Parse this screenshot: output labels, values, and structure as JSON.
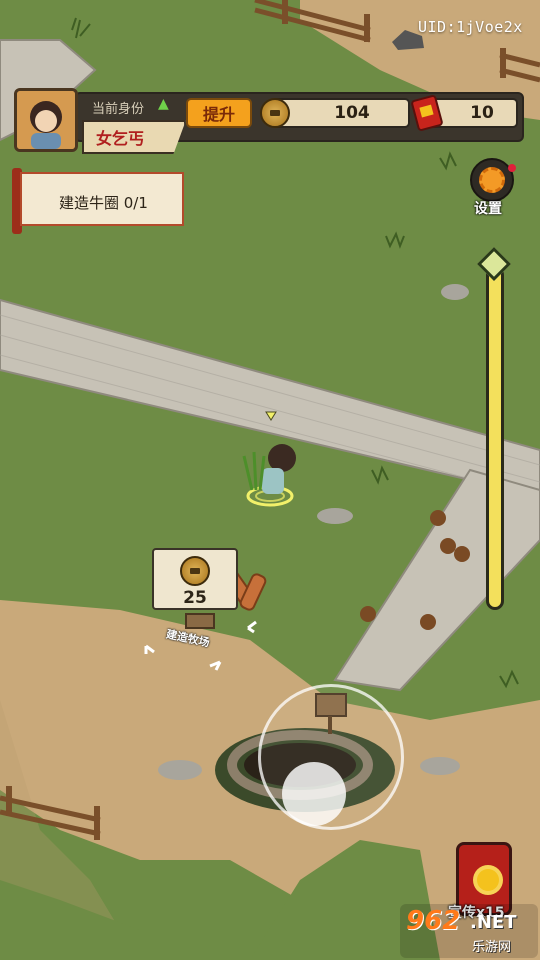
{
  "uid": "UID:1jVoe2x",
  "profile": {
    "identity_label": "当前身份",
    "rank": "女乞丐",
    "upgrade_label": "提升"
  },
  "resources": {
    "coins": "104",
    "tickets": "10"
  },
  "task": {
    "text": "建造牛圈 0/1"
  },
  "settings": {
    "label": "设置"
  },
  "build": {
    "cost": "25",
    "label": "建造牧场"
  },
  "promo": {
    "label": "宣传x15"
  },
  "watermark": {
    "number": "962",
    "domain": ".NET",
    "subtitle": "乐游网"
  },
  "colors": {
    "grass": "#6e8c45",
    "path": "#c9a97a",
    "road": "#c7c2b6",
    "accent": "#f4a11d",
    "rank_red": "#b01f1f"
  }
}
